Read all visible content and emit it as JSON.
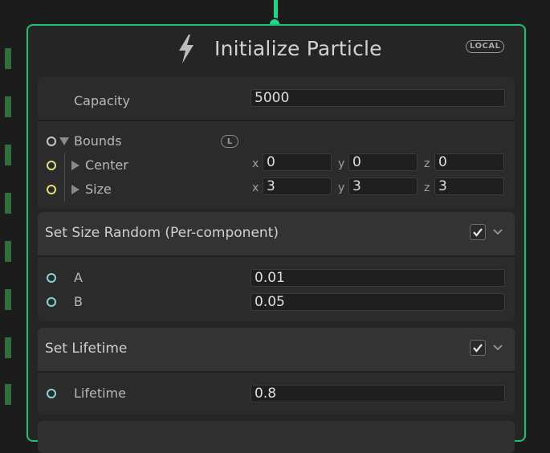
{
  "node": {
    "title": "Initialize Particle",
    "space_badge": "LOCAL",
    "accent_color": "#19c477",
    "icon": "lightning-bolt-icon"
  },
  "settings": {
    "capacity_label": "Capacity",
    "capacity_value": "5000",
    "bounds_label": "Bounds",
    "bounds_space_icon": "L",
    "center_label": "Center",
    "center": {
      "x": "0",
      "y": "0",
      "z": "0"
    },
    "size_label": "Size",
    "size": {
      "x": "3",
      "y": "3",
      "z": "3"
    },
    "axis_x": "x",
    "axis_y": "y",
    "axis_z": "z"
  },
  "blocks": [
    {
      "title": "Set Size Random (Per-component)",
      "enabled": true,
      "fields": [
        {
          "label": "A",
          "value": "0.01"
        },
        {
          "label": "B",
          "value": "0.05"
        }
      ]
    },
    {
      "title": "Set Lifetime",
      "enabled": true,
      "fields": [
        {
          "label": "Lifetime",
          "value": "0.8"
        }
      ]
    }
  ]
}
